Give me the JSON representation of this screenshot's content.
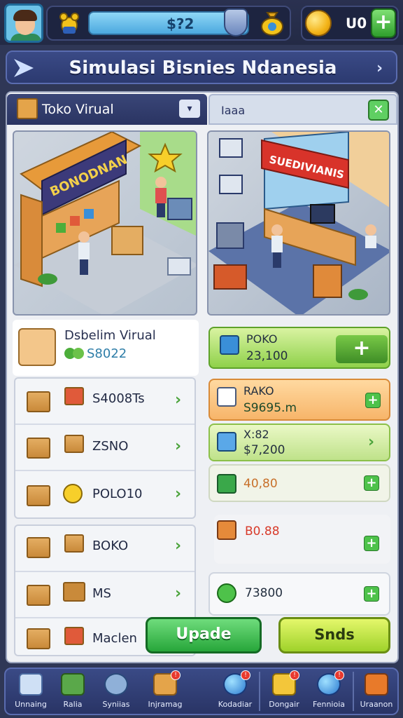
{
  "header": {
    "xp_value": "$?2",
    "coins": "ᑌ0",
    "plus": "+"
  },
  "title": "Simulasi Bisnies Ndanesia",
  "tabs": {
    "tab1_label": "Toko Virual",
    "tab2_label": "Iaaa"
  },
  "scene_signs": {
    "left": "BONODNAN",
    "right": "SUEDIVIANIS"
  },
  "profile": {
    "name": "Dsbelim Virual",
    "value": "S8022"
  },
  "left_list_1": [
    {
      "label": "S4008Ts"
    },
    {
      "label": "ZSNO"
    },
    {
      "label": "POLO10"
    }
  ],
  "left_list_2": [
    {
      "label": "BOKO"
    },
    {
      "label": "MS"
    },
    {
      "label": "Maclen"
    }
  ],
  "right_cards": {
    "green_title": "POKO",
    "green_value": "23,100",
    "orange_title": "RAKO",
    "orange_value": "S9695.m",
    "lime_title": "X:82",
    "lime_value": "$7,200",
    "light_value": "40,80",
    "red_value": "B0.88",
    "white_value": "73800"
  },
  "buttons": {
    "update": "Upade",
    "sends": "Snds"
  },
  "nav": [
    {
      "label": "Unnaing",
      "icon": "building-icon"
    },
    {
      "label": "Ralia",
      "icon": "store-icon"
    },
    {
      "label": "Syniias",
      "icon": "gear-icon"
    },
    {
      "label": "Injramag",
      "icon": "crate-icon"
    },
    {
      "label": "Kodadiar",
      "icon": "globe-icon"
    },
    {
      "label": "Dongair",
      "icon": "cube-icon"
    },
    {
      "label": "Fennioia",
      "icon": "world-icon"
    },
    {
      "label": "Uraanon",
      "icon": "card-icon"
    }
  ],
  "colors": {
    "accent_blue": "#3a4a86",
    "accent_green": "#27a63a",
    "coin_gold": "#f3b418"
  }
}
